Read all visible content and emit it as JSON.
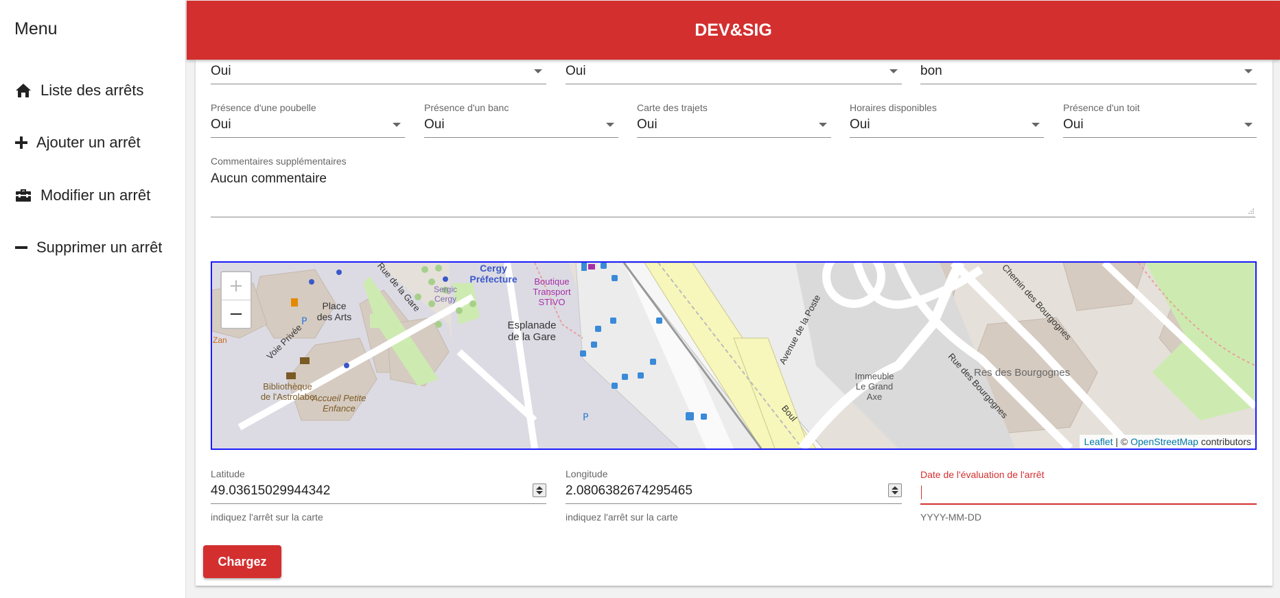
{
  "app": {
    "title": "DEV&SIG"
  },
  "sidebar": {
    "title": "Menu",
    "items": [
      {
        "label": "Liste des arrêts",
        "icon": "home-icon"
      },
      {
        "label": "Ajouter un arrêt",
        "icon": "plus-icon"
      },
      {
        "label": "Modifier un arrêt",
        "icon": "toolbox-icon"
      },
      {
        "label": "Supprimer un arrêt",
        "icon": "minus-icon"
      }
    ]
  },
  "form": {
    "row1": [
      {
        "value": "Oui"
      },
      {
        "value": "Oui"
      },
      {
        "value": "bon"
      }
    ],
    "row2": [
      {
        "label": "Présence d'une poubelle",
        "value": "Oui"
      },
      {
        "label": "Présence d'un banc",
        "value": "Oui"
      },
      {
        "label": "Carte des trajets",
        "value": "Oui"
      },
      {
        "label": "Horaires disponibles",
        "value": "Oui"
      },
      {
        "label": "Présence d'un toit",
        "value": "Oui"
      }
    ],
    "comments": {
      "label": "Commentaires supplémentaires",
      "value": "Aucun commentaire"
    },
    "latitude": {
      "label": "Latitude",
      "value": "49.03615029944342",
      "hint": "indiquez l'arrêt sur la carte"
    },
    "longitude": {
      "label": "Longitude",
      "value": "2.0806382674295465",
      "hint": "indiquez l'arrêt sur la carte"
    },
    "date": {
      "label": "Date de l'évaluation de l'arrêt",
      "value": "",
      "hint": "YYYY-MM-DD"
    },
    "submit_label": "Chargez"
  },
  "map": {
    "zoom_in": "+",
    "zoom_out": "−",
    "attribution": {
      "leaflet": "Leaflet",
      "sep": " | © ",
      "osm": "OpenStreetMap",
      "suffix": " contributors"
    },
    "labels": [
      {
        "text": "Cergy Préfecture",
        "color": "#3a58c8"
      },
      {
        "text": "Place des Arts",
        "color": "#333333"
      },
      {
        "text": "Rue de la Gare",
        "color": "#333333"
      },
      {
        "text": "Voie Privée",
        "color": "#333333"
      },
      {
        "text": "Sergic Cergy",
        "color": "#7a6ab0"
      },
      {
        "text": "Boutique Transport STIVO",
        "color": "#a62fa6"
      },
      {
        "text": "Esplanade de la Gare",
        "color": "#333333"
      },
      {
        "text": "Bibliothèque de l'Astrolabe",
        "color": "#7a5a25"
      },
      {
        "text": "Accueil Petite Enfance",
        "color": "#7a5a25"
      },
      {
        "text": "Avenue de la Poste",
        "color": "#333333"
      },
      {
        "text": "Chemin des Bourgognes",
        "color": "#333333"
      },
      {
        "text": "Rue des Bourgognes",
        "color": "#333333"
      },
      {
        "text": "Res des Bourgognes",
        "color": "#666666"
      },
      {
        "text": "Immeuble Le Grand Axe",
        "color": "#555555"
      },
      {
        "text": "Zan",
        "color": "#c86a1a"
      },
      {
        "text": "Boul",
        "color": "#333333"
      }
    ]
  },
  "colors": {
    "accent": "#d32f2f",
    "map_border": "#1a1aff"
  }
}
